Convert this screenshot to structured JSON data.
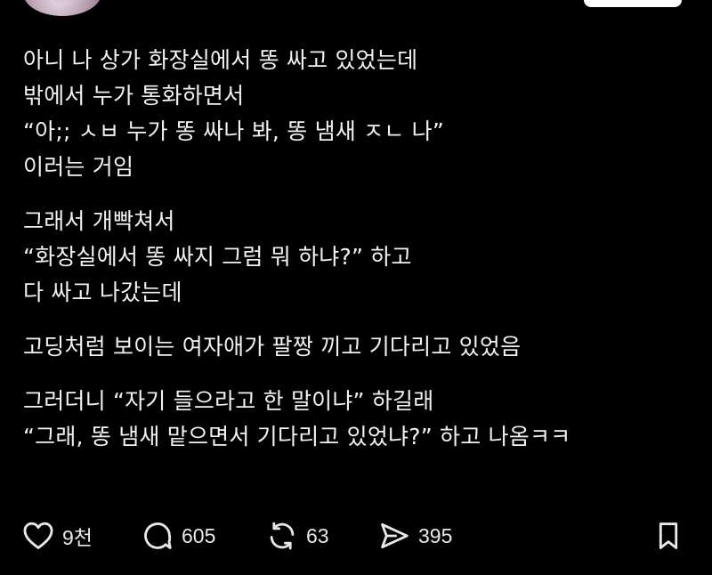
{
  "post": {
    "lines": [
      "아니 나 상가 화장실에서 똥 싸고 있었는데",
      "밖에서 누가 통화하면서",
      "“아;; ㅅㅂ 누가 똥 싸나 봐, 똥 냄새 ㅈㄴ 나”",
      "이러는 거임",
      "그래서 개빡쳐서",
      "“화장실에서 똥 싸지 그럼 뭐 하냐?” 하고",
      "다 싸고 나갔는데",
      "고딩처럼 보이는 여자애가 팔짱 끼고 기다리고 있었음",
      "그러더니 “자기 들으라고 한 말이냐” 하길래",
      "“그래, 똥 냄새 맡으면서 기다리고 있었냐?” 하고 나옴ㅋㅋ"
    ]
  },
  "actions": {
    "likes": "9천",
    "replies": "605",
    "reposts": "63",
    "shares": "395"
  },
  "icons": {
    "like": "heart-icon",
    "reply": "speech-bubble-icon",
    "repost": "repost-arrows-icon",
    "share": "send-icon",
    "bookmark": "bookmark-icon"
  },
  "colors": {
    "background": "#000000",
    "text": "#f2f2f2",
    "icon": "#e8e8e8"
  }
}
